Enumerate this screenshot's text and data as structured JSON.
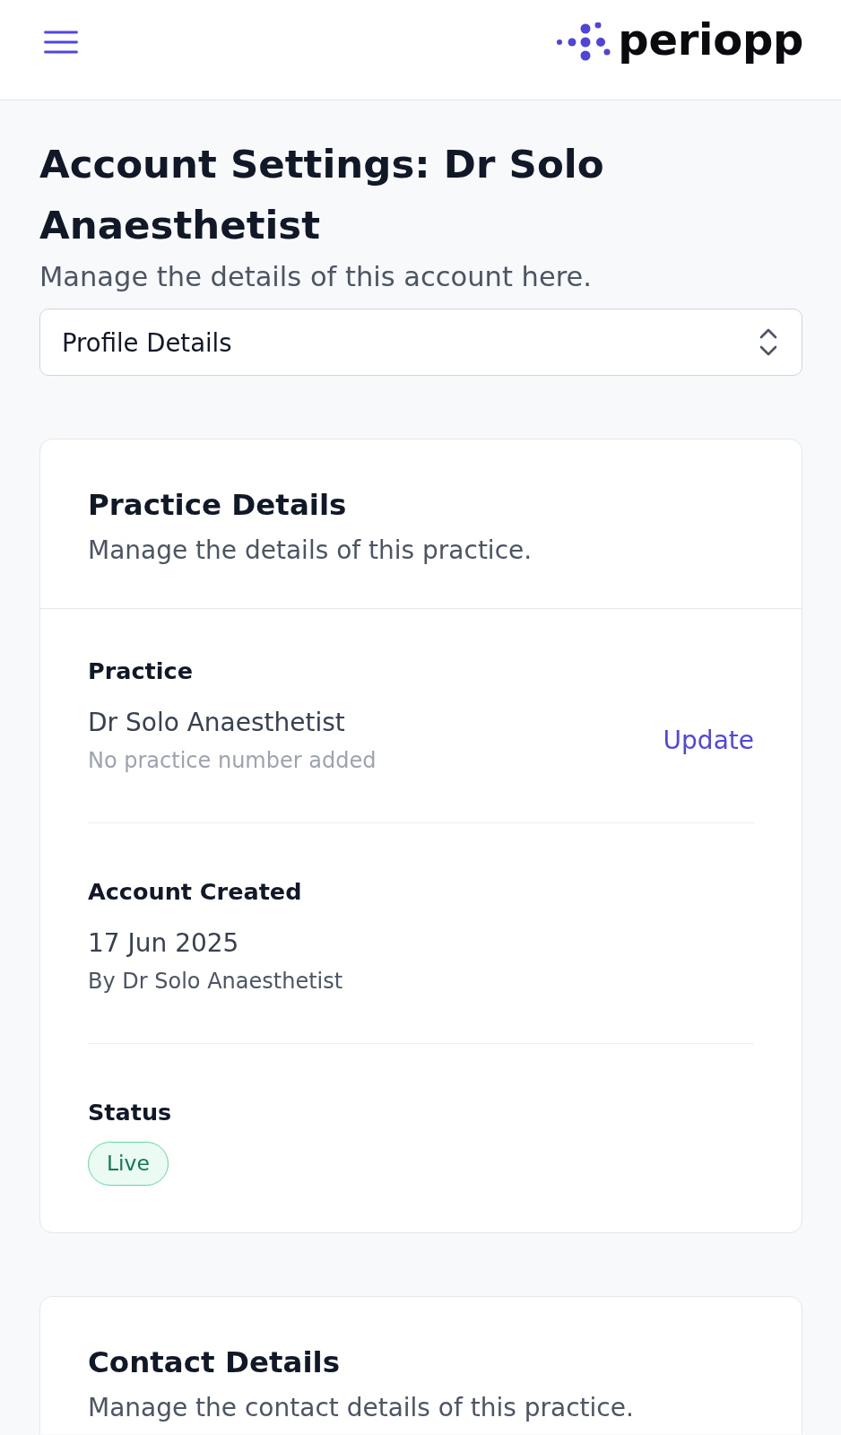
{
  "header": {
    "logo_text": "periopp"
  },
  "page": {
    "title": "Account Settings: Dr Solo Anaesthetist",
    "subtitle": "Manage the details of this account here."
  },
  "section_select": {
    "value": "Profile Details"
  },
  "cards": [
    {
      "title": "Practice Details",
      "subtitle": "Manage the details of this practice.",
      "fields": [
        {
          "kind": "text",
          "label": "Practice",
          "value": "Dr Solo Anaesthetist",
          "note": {
            "text": "No practice number added",
            "muted": true
          },
          "action": "Update"
        },
        {
          "kind": "text",
          "label": "Account Created",
          "value": "17 Jun 2025",
          "note": {
            "text": "By Dr Solo Anaesthetist",
            "muted": false
          }
        },
        {
          "kind": "status",
          "label": "Status",
          "badge": "Live"
        }
      ]
    },
    {
      "title": "Contact Details",
      "subtitle": "Manage the contact details of this practice."
    }
  ]
}
